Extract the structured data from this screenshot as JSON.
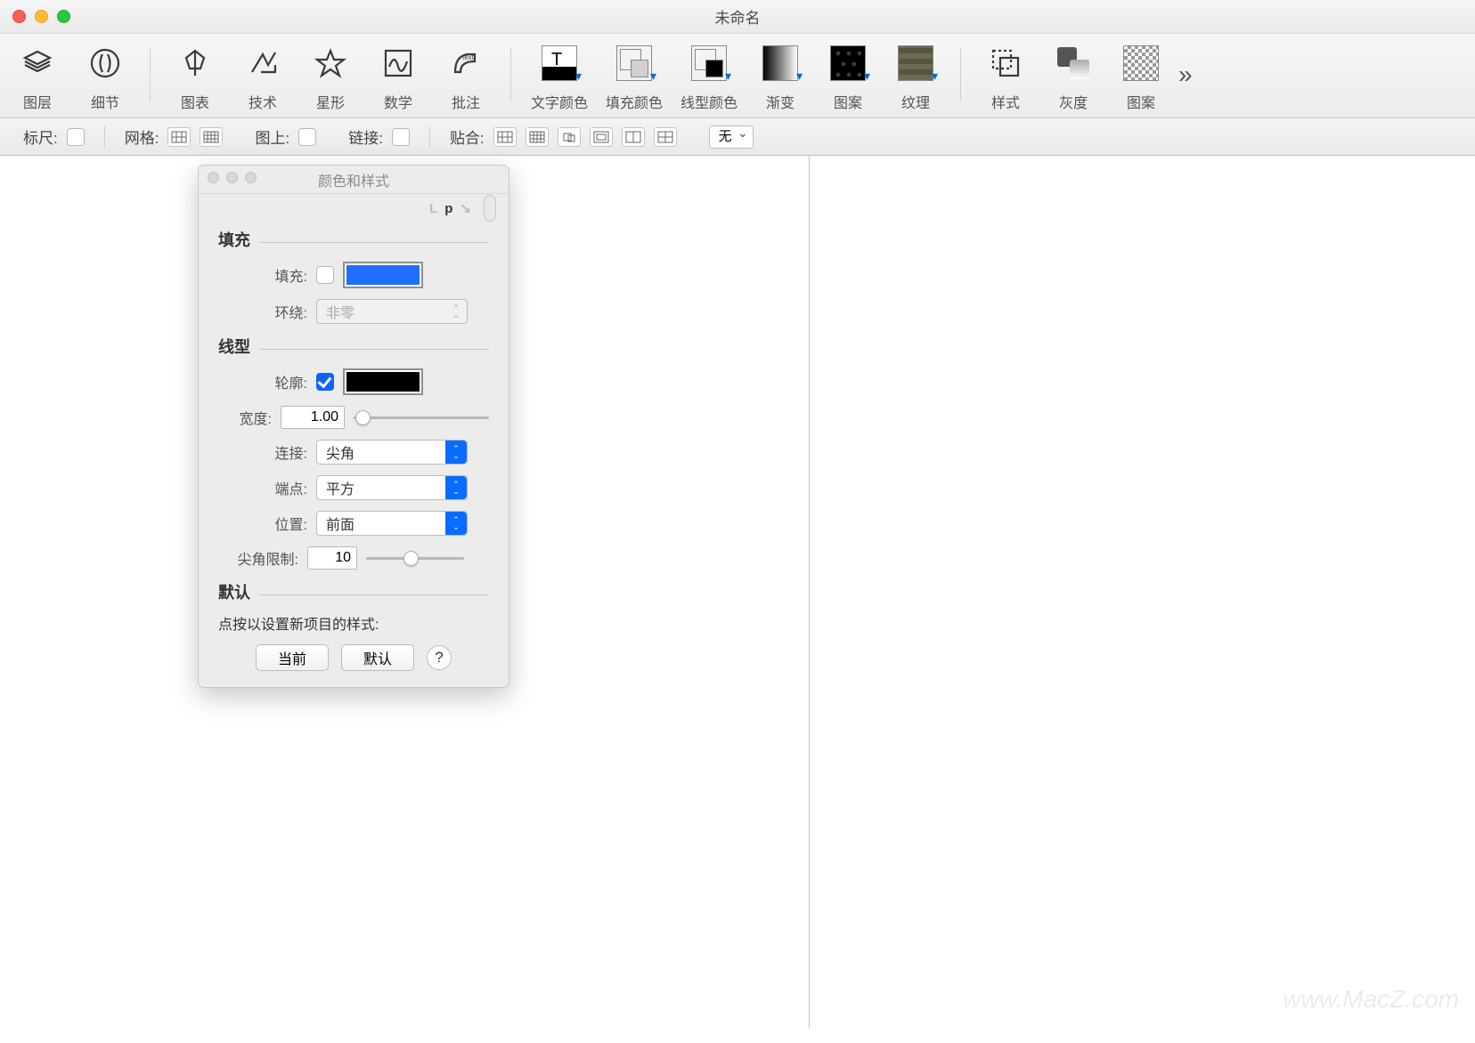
{
  "window": {
    "title": "未命名"
  },
  "toolbar": {
    "items": [
      {
        "name": "layers",
        "label": "图层"
      },
      {
        "name": "detail",
        "label": "细节"
      },
      {
        "name": "chart",
        "label": "图表"
      },
      {
        "name": "tech",
        "label": "技术"
      },
      {
        "name": "star",
        "label": "星形"
      },
      {
        "name": "math",
        "label": "数学"
      },
      {
        "name": "annotate",
        "label": "批注"
      },
      {
        "name": "text-color",
        "label": "文字颜色"
      },
      {
        "name": "fill-color",
        "label": "填充颜色"
      },
      {
        "name": "line-color",
        "label": "线型颜色"
      },
      {
        "name": "gradient",
        "label": "渐变"
      },
      {
        "name": "pattern-dots",
        "label": "图案"
      },
      {
        "name": "texture",
        "label": "纹理"
      },
      {
        "name": "style",
        "label": "样式"
      },
      {
        "name": "grayscale",
        "label": "灰度"
      },
      {
        "name": "pattern2",
        "label": "图案"
      }
    ],
    "more": "»"
  },
  "subbar": {
    "ruler": "标尺:",
    "grid": "网格:",
    "ontop": "图上:",
    "link": "链接:",
    "snap": "贴合:",
    "snap_select": "无"
  },
  "panel": {
    "title": "颜色和样式",
    "tab_p": "p",
    "fill_section": "填充",
    "fill_label": "填充:",
    "fill_checked": false,
    "fill_color": "#1f6fff",
    "wrap_label": "环绕:",
    "wrap_value": "非零",
    "line_section": "线型",
    "outline_label": "轮廓:",
    "outline_checked": true,
    "outline_color": "#000000",
    "width_label": "宽度:",
    "width_value": "1.00",
    "join_label": "连接:",
    "join_value": "尖角",
    "cap_label": "端点:",
    "cap_value": "平方",
    "position_label": "位置:",
    "position_value": "前面",
    "miter_label": "尖角限制:",
    "miter_value": "10",
    "default_section": "默认",
    "hint": "点按以设置新项目的样式:",
    "btn_current": "当前",
    "btn_default": "默认",
    "help": "?"
  },
  "watermark": "www.MacZ.com"
}
